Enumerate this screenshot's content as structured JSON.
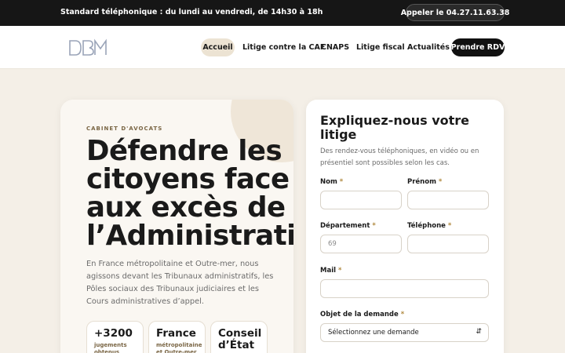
{
  "topbar": {
    "text": "Standard téléphonique : du lundi au vendredi, de 14h30 à 18h",
    "phone_button": "Appeler le 04.27.11.63.38"
  },
  "header": {
    "logo": "DBM logo",
    "nav": [
      {
        "label": "Accueil",
        "active": true
      },
      {
        "label": "Litige contre la CAF",
        "active": false
      },
      {
        "label": "CNAPS",
        "active": false
      },
      {
        "label": "Litige fiscal",
        "active": false
      },
      {
        "label": "Actualités",
        "active": false
      }
    ],
    "cta": "Prendre RDV"
  },
  "hero": {
    "eyebrow": "CABINET D'AVOCATS",
    "title_lines": [
      "Défendre les",
      "citoyens face",
      "aux excès de",
      "l’Administration"
    ],
    "description": "En France métropolitaine et Outre-mer, nous agissons devant les Tribunaux administratifs, les Pôles sociaux des Tribunaux judiciaires et les Cours administratives d’appel.",
    "stats": [
      {
        "value": "+3200",
        "label": "jugements obtenus"
      },
      {
        "value": "France",
        "label": "métropolitaine et Outre-mer"
      },
      {
        "value": "Conseil d’État",
        "label": ""
      }
    ]
  },
  "form": {
    "title": "Expliquez-nous votre litige",
    "subtitle": "Des rendez-vous téléphoniques, en vidéo ou en présentiel sont possibles selon les cas.",
    "fields": {
      "nom": {
        "label": "Nom",
        "required": "*",
        "value": ""
      },
      "prenom": {
        "label": "Prénom",
        "required": "*",
        "value": ""
      },
      "departement": {
        "label": "Département",
        "required": "*",
        "placeholder": "69",
        "value": ""
      },
      "telephone": {
        "label": "Téléphone",
        "required": "*",
        "value": ""
      },
      "mail": {
        "label": "Mail",
        "required": "*",
        "value": ""
      },
      "objet": {
        "label": "Objet de la demande",
        "required": "*",
        "selected": "Sélectionnez une demande"
      }
    }
  },
  "colors": {
    "topbar_bg": "#161616",
    "page_bg": "#f4efe7",
    "accent": "#b0893f",
    "active_nav_bg": "#ece3d3",
    "cta_bg": "#111111"
  }
}
